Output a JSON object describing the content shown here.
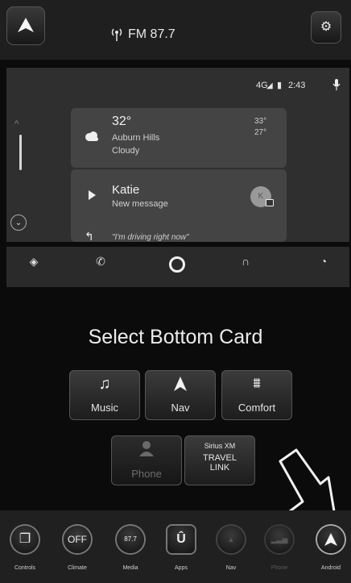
{
  "header": {
    "radio_icon": "radio-signal-icon",
    "station": "FM 87.7",
    "settings_icon": "gear-icon"
  },
  "android_auto": {
    "status": {
      "signal": "4G",
      "time": "2:43"
    },
    "weather": {
      "temp": "32°",
      "location": "Auburn Hills",
      "condition": "Cloudy",
      "high": "33°",
      "low": "27°"
    },
    "message": {
      "sender": "Katie",
      "subtitle": "New message",
      "avatar_initial": "K",
      "reply": "\"I'm driving right now\""
    },
    "nav_icons": [
      "navigation-icon",
      "phone-icon",
      "home-icon",
      "headphones-icon",
      "recents-icon"
    ]
  },
  "bottom_card": {
    "title": "Select Bottom Card",
    "tiles": {
      "music": "Music",
      "nav": "Nav",
      "comfort": "Comfort",
      "phone": "Phone",
      "sxm_line1": "Sirius XM",
      "sxm_line2": "TRAVEL",
      "sxm_line3": "LINK"
    }
  },
  "dock": {
    "controls": "Controls",
    "climate": "Climate",
    "climate_value": "OFF",
    "media": "Media",
    "media_value": "87.7",
    "apps": "Apps",
    "nav": "Nav",
    "phone": "Phone",
    "android": "Android"
  }
}
